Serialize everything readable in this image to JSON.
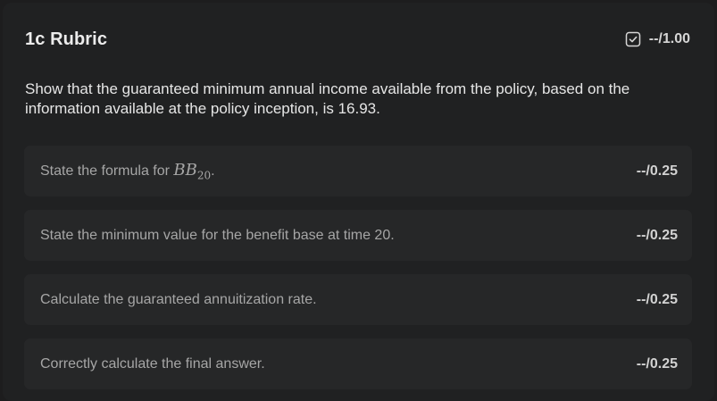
{
  "rubric": {
    "title": "1c Rubric",
    "total_score": "--/1.00",
    "description": "Show that the guaranteed minimum annual income available from the policy, based on the information available at the policy inception, is 16.93.",
    "criteria": [
      {
        "label_prefix": "State the formula for ",
        "math_main": "BB",
        "math_sub": "20",
        "label_suffix": ".",
        "score": "--/0.25"
      },
      {
        "label": "State the minimum value for the benefit base at time 20.",
        "score": "--/0.25"
      },
      {
        "label": "Calculate the guaranteed annuitization rate.",
        "score": "--/0.25"
      },
      {
        "label": "Correctly calculate the final answer.",
        "score": "--/0.25"
      }
    ]
  },
  "icons": {
    "total_icon": "checkbox-icon"
  }
}
